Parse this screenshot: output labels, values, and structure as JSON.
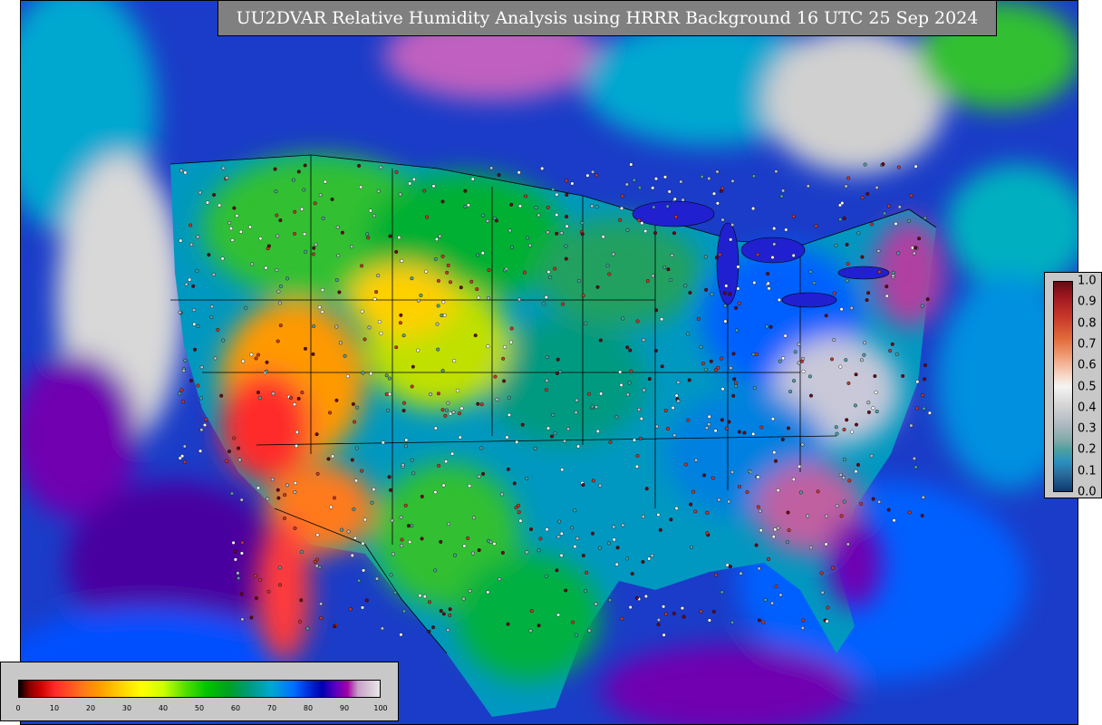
{
  "title": "UU2DVAR Relative Humidity Analysis using HRRR Background 16 UTC 25 Sep 2024",
  "rh_legend": {
    "ticks": [
      "0",
      "10",
      "20",
      "30",
      "40",
      "50",
      "60",
      "70",
      "80",
      "90",
      "100"
    ]
  },
  "conf_legend": {
    "ticks": [
      "1.0",
      "0.9",
      "0.8",
      "0.7",
      "0.6",
      "0.5",
      "0.4",
      "0.3",
      "0.2",
      "0.1",
      "0.0"
    ]
  },
  "colors": {
    "ocean": "#1a3cc8",
    "dry": "#ff2a2a",
    "moist": "#00c400",
    "saturated": "#e0e0e0",
    "station_marker": "#ffffff",
    "banner": "#808080"
  }
}
